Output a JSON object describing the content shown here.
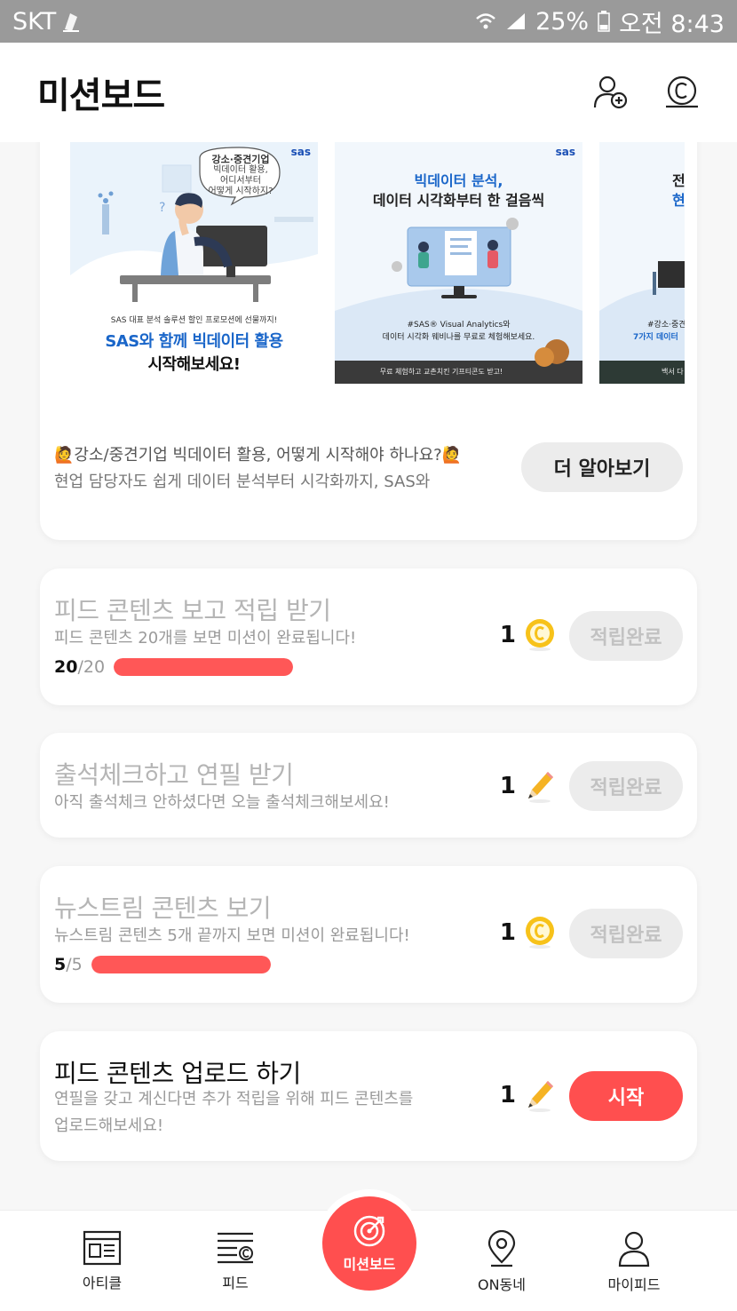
{
  "status_bar": {
    "carrier": "SKT",
    "battery": "25%",
    "time": "오전 8:43"
  },
  "header": {
    "title": "미션보드"
  },
  "banner": {
    "slides": [
      {
        "brand": "sas",
        "bubble": [
          "강소·중견기업",
          "빅데이터 활용,",
          "어디서부터",
          "어떻게 시작하지?"
        ],
        "sub": "SAS 대표 분석 솔루션 할인 프로모션에 선물까지!",
        "line1": "SAS와 함께 빅데이터 활용",
        "line2": "시작해보세요!"
      },
      {
        "brand": "sas",
        "head1": "빅데이터 분석,",
        "head2": "데이터 시각화부터 한 걸음씩",
        "sub1": "#SAS® Visual Analytics와",
        "sub2": "데이터 시각화 웨비나를 무료로 체험해보세요.",
        "footer": "무료 체험하고 교촌치킨 기프티콘도 받고!"
      },
      {
        "head1": "전",
        "head2": "현",
        "sub1": "#강소·중견",
        "sub2": "7가지 데이터",
        "footer": "백서 다"
      }
    ],
    "text_line1": "🙋강소/중견기업 빅데이터 활용, 어떻게 시작해야 하나요?🙋",
    "text_line2": "현업 담당자도 쉽게 데이터 분석부터 시각화까지, SAS와",
    "more_label": "더 알아보기"
  },
  "missions": [
    {
      "title": "피드 콘텐츠 보고 적립 받기",
      "desc": "피드 콘텐츠 20개를 보면 미션이 완료됩니다!",
      "progress_current": "20",
      "progress_total": "/20",
      "progress_fraction": 1.0,
      "reward_amount": "1",
      "reward_icon": "coin-icon",
      "action_label": "적립완료",
      "status": "done"
    },
    {
      "title": "출석체크하고 연필 받기",
      "desc": "아직 출석체크 안하셨다면 오늘 출석체크해보세요!",
      "reward_amount": "1",
      "reward_icon": "pencil-icon",
      "action_label": "적립완료",
      "status": "done"
    },
    {
      "title": "뉴스트림 콘텐츠 보기",
      "desc": "뉴스트림 콘텐츠 5개 끝까지 보면 미션이 완료됩니다!",
      "progress_current": "5",
      "progress_total": "/5",
      "progress_fraction": 1.0,
      "reward_amount": "1",
      "reward_icon": "coin-icon",
      "action_label": "적립완료",
      "status": "done"
    },
    {
      "title": "피드 콘텐츠 업로드 하기",
      "desc_line1": "연필을 갖고 계신다면 추가 적립을 위해 피드 콘텐츠를",
      "desc_line2": "업로드해보세요!",
      "reward_amount": "1",
      "reward_icon": "pencil-icon",
      "action_label": "시작",
      "status": "start"
    }
  ],
  "bottom_nav": {
    "items": [
      {
        "label": "아티클",
        "icon": "article-icon"
      },
      {
        "label": "피드",
        "icon": "feed-icon"
      },
      {
        "label": "미션보드",
        "icon": "target-icon"
      },
      {
        "label": "ON동네",
        "icon": "location-icon"
      },
      {
        "label": "마이피드",
        "icon": "profile-icon"
      }
    ]
  },
  "colors": {
    "accent": "#ff4f4f",
    "coin": "#f7c21a",
    "pencil": "#f5b324"
  }
}
